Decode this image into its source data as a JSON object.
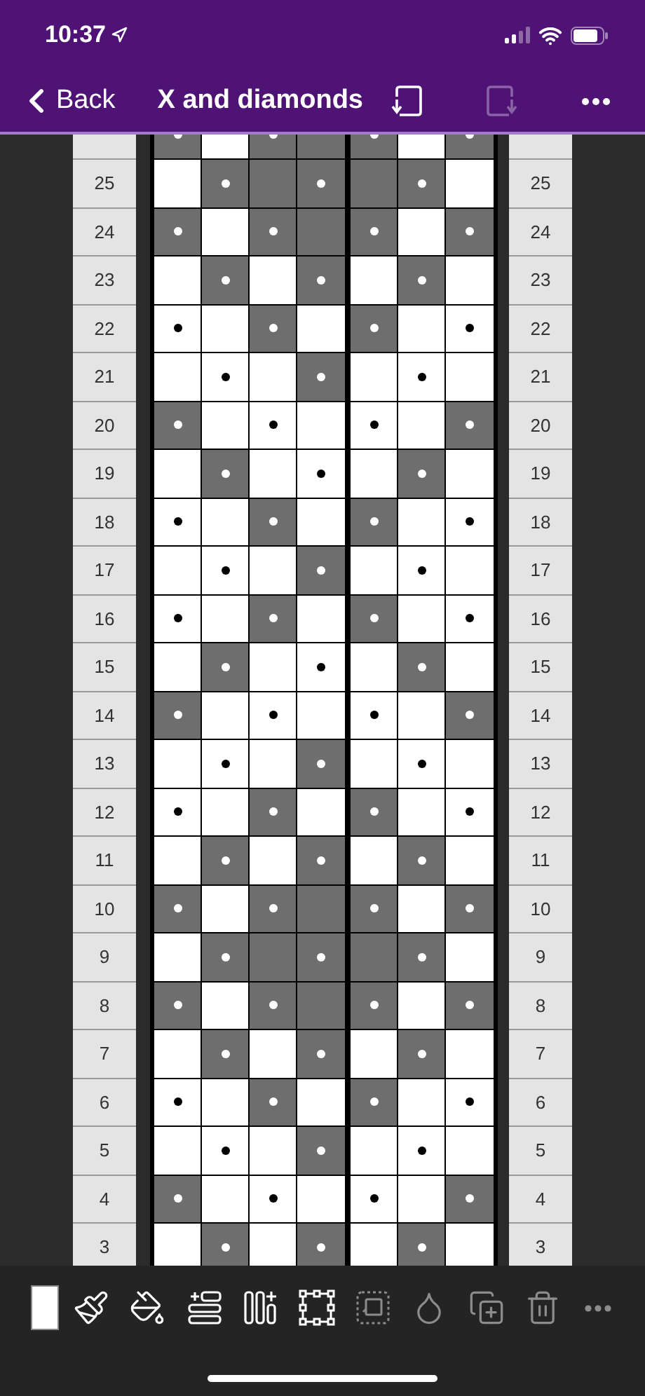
{
  "status_bar": {
    "time": "10:37"
  },
  "nav": {
    "back": "Back",
    "title": "X and diamonds",
    "actions": [
      {
        "kind": "rotate-left",
        "disabled": false
      },
      {
        "kind": "rotate-right",
        "disabled": true
      },
      {
        "kind": "more",
        "disabled": false
      }
    ]
  },
  "chart": {
    "rows": [
      {
        "cells": [
          {
            "dark": true,
            "dot": true
          },
          {
            "dark": false,
            "dot": false
          },
          {
            "dark": true,
            "dot": true
          },
          {
            "dark": true,
            "dot": false
          },
          {
            "dark": true,
            "dot": true
          },
          {
            "dark": false,
            "dot": false
          },
          {
            "dark": true,
            "dot": true
          }
        ]
      },
      {
        "left_label": "25",
        "right_label": "25",
        "cells": [
          {
            "dark": false,
            "dot": false
          },
          {
            "dark": true,
            "dot": true
          },
          {
            "dark": true,
            "dot": false
          },
          {
            "dark": true,
            "dot": true
          },
          {
            "dark": true,
            "dot": false
          },
          {
            "dark": true,
            "dot": true
          },
          {
            "dark": false,
            "dot": false
          }
        ]
      },
      {
        "left_label": "24",
        "right_label": "24",
        "cells": [
          {
            "dark": true,
            "dot": true
          },
          {
            "dark": false,
            "dot": false
          },
          {
            "dark": true,
            "dot": true
          },
          {
            "dark": true,
            "dot": false
          },
          {
            "dark": true,
            "dot": true
          },
          {
            "dark": false,
            "dot": false
          },
          {
            "dark": true,
            "dot": true
          }
        ]
      },
      {
        "left_label": "23",
        "right_label": "23",
        "cells": [
          {
            "dark": false,
            "dot": false
          },
          {
            "dark": true,
            "dot": true
          },
          {
            "dark": false,
            "dot": false
          },
          {
            "dark": true,
            "dot": true
          },
          {
            "dark": false,
            "dot": false
          },
          {
            "dark": true,
            "dot": true
          },
          {
            "dark": false,
            "dot": false
          }
        ]
      },
      {
        "left_label": "22",
        "right_label": "22",
        "cells": [
          {
            "dark": false,
            "dot": true
          },
          {
            "dark": false,
            "dot": false
          },
          {
            "dark": true,
            "dot": true
          },
          {
            "dark": false,
            "dot": false
          },
          {
            "dark": true,
            "dot": true
          },
          {
            "dark": false,
            "dot": false
          },
          {
            "dark": false,
            "dot": true
          }
        ]
      },
      {
        "left_label": "21",
        "right_label": "21",
        "cells": [
          {
            "dark": false,
            "dot": false
          },
          {
            "dark": false,
            "dot": true
          },
          {
            "dark": false,
            "dot": false
          },
          {
            "dark": true,
            "dot": true
          },
          {
            "dark": false,
            "dot": false
          },
          {
            "dark": false,
            "dot": true
          },
          {
            "dark": false,
            "dot": false
          }
        ]
      },
      {
        "left_label": "20",
        "right_label": "20",
        "cells": [
          {
            "dark": true,
            "dot": true
          },
          {
            "dark": false,
            "dot": false
          },
          {
            "dark": false,
            "dot": true
          },
          {
            "dark": false,
            "dot": false
          },
          {
            "dark": false,
            "dot": true
          },
          {
            "dark": false,
            "dot": false
          },
          {
            "dark": true,
            "dot": true
          }
        ]
      },
      {
        "left_label": "19",
        "right_label": "19",
        "cells": [
          {
            "dark": false,
            "dot": false
          },
          {
            "dark": true,
            "dot": true
          },
          {
            "dark": false,
            "dot": false
          },
          {
            "dark": false,
            "dot": true
          },
          {
            "dark": false,
            "dot": false
          },
          {
            "dark": true,
            "dot": true
          },
          {
            "dark": false,
            "dot": false
          }
        ]
      },
      {
        "left_label": "18",
        "right_label": "18",
        "cells": [
          {
            "dark": false,
            "dot": true
          },
          {
            "dark": false,
            "dot": false
          },
          {
            "dark": true,
            "dot": true
          },
          {
            "dark": false,
            "dot": false
          },
          {
            "dark": true,
            "dot": true
          },
          {
            "dark": false,
            "dot": false
          },
          {
            "dark": false,
            "dot": true
          }
        ]
      },
      {
        "left_label": "17",
        "right_label": "17",
        "cells": [
          {
            "dark": false,
            "dot": false
          },
          {
            "dark": false,
            "dot": true
          },
          {
            "dark": false,
            "dot": false
          },
          {
            "dark": true,
            "dot": true
          },
          {
            "dark": false,
            "dot": false
          },
          {
            "dark": false,
            "dot": true
          },
          {
            "dark": false,
            "dot": false
          }
        ]
      },
      {
        "left_label": "16",
        "right_label": "16",
        "cells": [
          {
            "dark": false,
            "dot": true
          },
          {
            "dark": false,
            "dot": false
          },
          {
            "dark": true,
            "dot": true
          },
          {
            "dark": false,
            "dot": false
          },
          {
            "dark": true,
            "dot": true
          },
          {
            "dark": false,
            "dot": false
          },
          {
            "dark": false,
            "dot": true
          }
        ]
      },
      {
        "left_label": "15",
        "right_label": "15",
        "cells": [
          {
            "dark": false,
            "dot": false
          },
          {
            "dark": true,
            "dot": true
          },
          {
            "dark": false,
            "dot": false
          },
          {
            "dark": false,
            "dot": true
          },
          {
            "dark": false,
            "dot": false
          },
          {
            "dark": true,
            "dot": true
          },
          {
            "dark": false,
            "dot": false
          }
        ]
      },
      {
        "left_label": "14",
        "right_label": "14",
        "cells": [
          {
            "dark": true,
            "dot": true
          },
          {
            "dark": false,
            "dot": false
          },
          {
            "dark": false,
            "dot": true
          },
          {
            "dark": false,
            "dot": false
          },
          {
            "dark": false,
            "dot": true
          },
          {
            "dark": false,
            "dot": false
          },
          {
            "dark": true,
            "dot": true
          }
        ]
      },
      {
        "left_label": "13",
        "right_label": "13",
        "cells": [
          {
            "dark": false,
            "dot": false
          },
          {
            "dark": false,
            "dot": true
          },
          {
            "dark": false,
            "dot": false
          },
          {
            "dark": true,
            "dot": true
          },
          {
            "dark": false,
            "dot": false
          },
          {
            "dark": false,
            "dot": true
          },
          {
            "dark": false,
            "dot": false
          }
        ]
      },
      {
        "left_label": "12",
        "right_label": "12",
        "cells": [
          {
            "dark": false,
            "dot": true
          },
          {
            "dark": false,
            "dot": false
          },
          {
            "dark": true,
            "dot": true
          },
          {
            "dark": false,
            "dot": false
          },
          {
            "dark": true,
            "dot": true
          },
          {
            "dark": false,
            "dot": false
          },
          {
            "dark": false,
            "dot": true
          }
        ]
      },
      {
        "left_label": "11",
        "right_label": "11",
        "cells": [
          {
            "dark": false,
            "dot": false
          },
          {
            "dark": true,
            "dot": true
          },
          {
            "dark": false,
            "dot": false
          },
          {
            "dark": true,
            "dot": true
          },
          {
            "dark": false,
            "dot": false
          },
          {
            "dark": true,
            "dot": true
          },
          {
            "dark": false,
            "dot": false
          }
        ]
      },
      {
        "left_label": "10",
        "right_label": "10",
        "cells": [
          {
            "dark": true,
            "dot": true
          },
          {
            "dark": false,
            "dot": false
          },
          {
            "dark": true,
            "dot": true
          },
          {
            "dark": true,
            "dot": false
          },
          {
            "dark": true,
            "dot": true
          },
          {
            "dark": false,
            "dot": false
          },
          {
            "dark": true,
            "dot": true
          }
        ]
      },
      {
        "left_label": "9",
        "right_label": "9",
        "cells": [
          {
            "dark": false,
            "dot": false
          },
          {
            "dark": true,
            "dot": true
          },
          {
            "dark": true,
            "dot": false
          },
          {
            "dark": true,
            "dot": true
          },
          {
            "dark": true,
            "dot": false
          },
          {
            "dark": true,
            "dot": true
          },
          {
            "dark": false,
            "dot": false
          }
        ]
      },
      {
        "left_label": "8",
        "right_label": "8",
        "cells": [
          {
            "dark": true,
            "dot": true
          },
          {
            "dark": false,
            "dot": false
          },
          {
            "dark": true,
            "dot": true
          },
          {
            "dark": true,
            "dot": false
          },
          {
            "dark": true,
            "dot": true
          },
          {
            "dark": false,
            "dot": false
          },
          {
            "dark": true,
            "dot": true
          }
        ]
      },
      {
        "left_label": "7",
        "right_label": "7",
        "cells": [
          {
            "dark": false,
            "dot": false
          },
          {
            "dark": true,
            "dot": true
          },
          {
            "dark": false,
            "dot": false
          },
          {
            "dark": true,
            "dot": true
          },
          {
            "dark": false,
            "dot": false
          },
          {
            "dark": true,
            "dot": true
          },
          {
            "dark": false,
            "dot": false
          }
        ]
      },
      {
        "left_label": "6",
        "right_label": "6",
        "cells": [
          {
            "dark": false,
            "dot": true
          },
          {
            "dark": false,
            "dot": false
          },
          {
            "dark": true,
            "dot": true
          },
          {
            "dark": false,
            "dot": false
          },
          {
            "dark": true,
            "dot": true
          },
          {
            "dark": false,
            "dot": false
          },
          {
            "dark": false,
            "dot": true
          }
        ]
      },
      {
        "left_label": "5",
        "right_label": "5",
        "cells": [
          {
            "dark": false,
            "dot": false
          },
          {
            "dark": false,
            "dot": true
          },
          {
            "dark": false,
            "dot": false
          },
          {
            "dark": true,
            "dot": true
          },
          {
            "dark": false,
            "dot": false
          },
          {
            "dark": false,
            "dot": true
          },
          {
            "dark": false,
            "dot": false
          }
        ]
      },
      {
        "left_label": "4",
        "right_label": "4",
        "cells": [
          {
            "dark": true,
            "dot": true
          },
          {
            "dark": false,
            "dot": false
          },
          {
            "dark": false,
            "dot": true
          },
          {
            "dark": false,
            "dot": false
          },
          {
            "dark": false,
            "dot": true
          },
          {
            "dark": false,
            "dot": false
          },
          {
            "dark": true,
            "dot": true
          }
        ]
      },
      {
        "left_label": "3",
        "right_label": "3",
        "cells": [
          {
            "dark": false,
            "dot": false
          },
          {
            "dark": true,
            "dot": true
          },
          {
            "dark": false,
            "dot": false
          },
          {
            "dark": true,
            "dot": true
          },
          {
            "dark": false,
            "dot": false
          },
          {
            "dark": true,
            "dot": true
          },
          {
            "dark": false,
            "dot": false
          }
        ]
      }
    ]
  },
  "toolbar": [
    {
      "kind": "swatch",
      "color": "#ffffff",
      "disabled": false
    },
    {
      "kind": "brush",
      "disabled": false
    },
    {
      "kind": "bucket",
      "disabled": false
    },
    {
      "kind": "add-row",
      "disabled": false
    },
    {
      "kind": "add-column",
      "disabled": false
    },
    {
      "kind": "select",
      "disabled": false
    },
    {
      "kind": "move-selection",
      "disabled": true
    },
    {
      "kind": "drop",
      "disabled": true
    },
    {
      "kind": "duplicate",
      "disabled": true
    },
    {
      "kind": "delete",
      "disabled": true
    },
    {
      "kind": "more",
      "disabled": true
    }
  ]
}
